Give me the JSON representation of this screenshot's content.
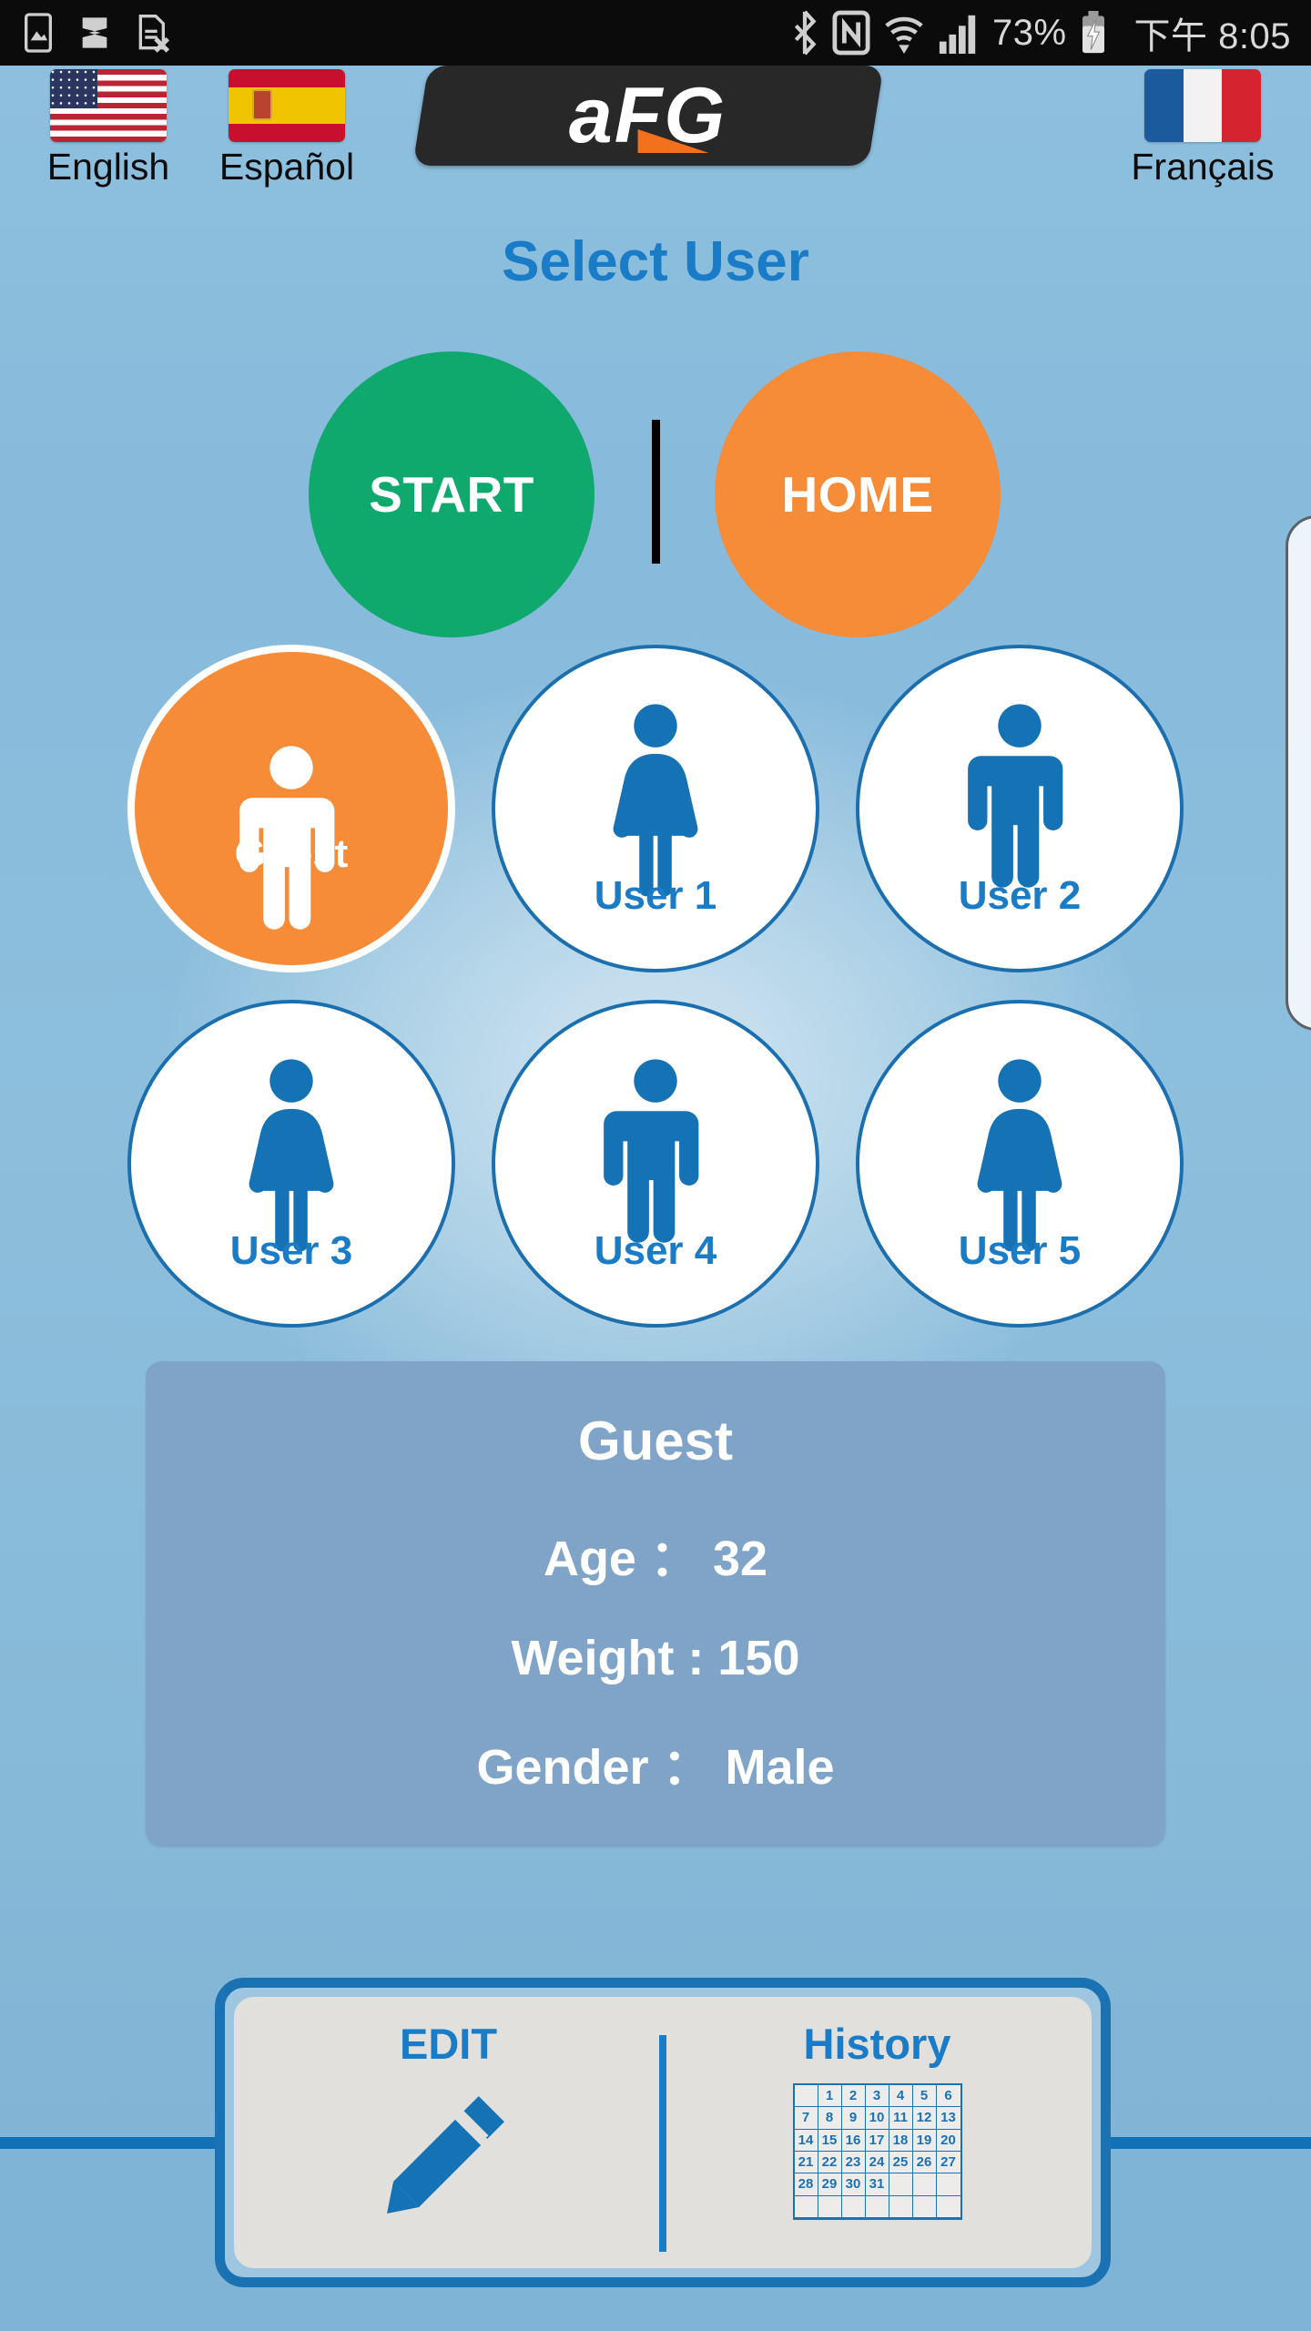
{
  "statusbar": {
    "left_icons": [
      "image-icon",
      "s-app-icon",
      "sim-card-off-icon"
    ],
    "right_icons": [
      "bluetooth-icon",
      "nfc-icon",
      "wifi-icon",
      "signal-icon"
    ],
    "battery_percent": "73%",
    "battery_icon": "battery-charging-icon",
    "time": "下午 8:05"
  },
  "header": {
    "languages": [
      {
        "label": "English",
        "flag": "us-flag-icon"
      },
      {
        "label": "Español",
        "flag": "spain-flag-icon"
      },
      {
        "label": "Français",
        "flag": "france-flag-icon"
      }
    ],
    "logo_text": "aFG",
    "logo_name": "afg-logo"
  },
  "page": {
    "title": "Select User"
  },
  "actions": {
    "start_label": "START",
    "home_label": "HOME",
    "start_color": "#0fa96e",
    "home_color": "#f68b38"
  },
  "users": [
    {
      "label": "Guest",
      "gender": "male",
      "selected": true
    },
    {
      "label": "User 1",
      "gender": "female",
      "selected": false
    },
    {
      "label": "User 2",
      "gender": "male",
      "selected": false
    },
    {
      "label": "User 3",
      "gender": "female",
      "selected": false
    },
    {
      "label": "User 4",
      "gender": "male",
      "selected": false
    },
    {
      "label": "User 5",
      "gender": "female",
      "selected": false
    }
  ],
  "info": {
    "name": "Guest",
    "age": "Age ： 32",
    "weight": "Weight : 150",
    "gender": "Gender ： Male"
  },
  "bottom": {
    "edit_label": "EDIT",
    "edit_icon": "pencil-icon",
    "history_label": "History",
    "history_icon": "calendar-icon",
    "calendar_days": [
      "",
      "1",
      "2",
      "3",
      "4",
      "5",
      "6",
      "7",
      "8",
      "9",
      "10",
      "11",
      "12",
      "13",
      "14",
      "15",
      "16",
      "17",
      "18",
      "19",
      "20",
      "21",
      "22",
      "23",
      "24",
      "25",
      "26",
      "27",
      "28",
      "29",
      "30",
      "31",
      "",
      "",
      "",
      "",
      "",
      "",
      "",
      "",
      "",
      ""
    ]
  },
  "colors": {
    "accent_blue": "#1a7cc6",
    "border_blue": "#1b6fae",
    "orange": "#f68b38",
    "green": "#0fa96e",
    "panel_blue": "#7fa4c8"
  }
}
